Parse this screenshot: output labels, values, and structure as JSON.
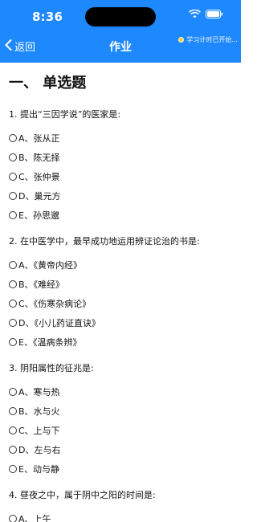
{
  "status_bar": {
    "time": "8:36"
  },
  "nav": {
    "back_label": "返回",
    "title": "作业",
    "timer_text": "学习计时已开始..."
  },
  "section_title": "一、 单选题",
  "questions": [
    {
      "stem": "1. 提出“三因学说”的医家是:",
      "options": [
        "A、张从正",
        "B、陈无择",
        "C、张仲景",
        "D、巢元方",
        "E、孙思邈"
      ]
    },
    {
      "stem": "2. 在中医学中，最早成功地运用辨证论治的书是:",
      "options": [
        "A、《黄帝内经》",
        "B、《难经》",
        "C、《伤寒杂病论》",
        "D、《小儿药证直诀》",
        "E、《温病条辨》"
      ]
    },
    {
      "stem": "3. 阴阳属性的征兆是:",
      "options": [
        "A、寒与热",
        "B、水与火",
        "C、上与下",
        "D、左与右",
        "E、动与静"
      ]
    },
    {
      "stem": "4. 昼夜之中，属于阴中之阳的时间是:",
      "options": [
        "A、上午"
      ]
    }
  ]
}
